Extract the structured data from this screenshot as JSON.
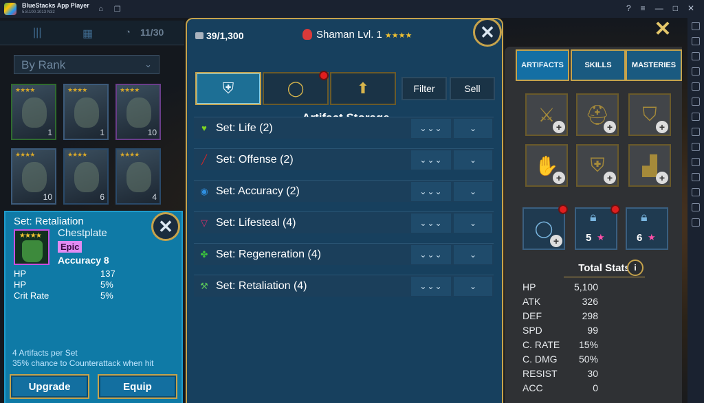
{
  "titlebar": {
    "app_name": "BlueStacks App Player",
    "version": "5.8.100.1013 N32"
  },
  "roster": {
    "count": "11/30",
    "sort_label": "By Rank",
    "heroes": [
      {
        "level": "1"
      },
      {
        "level": "1"
      },
      {
        "level": "10"
      },
      {
        "level": "10"
      },
      {
        "level": "6"
      },
      {
        "level": "4"
      }
    ],
    "hero_stars": "★★★★"
  },
  "artifact_info": {
    "set_title": "Set: Retaliation",
    "item_stars": "★★★★",
    "slot": "Chestplate",
    "rarity": "Epic",
    "main_stat": "Accuracy 8",
    "substats": [
      {
        "name": "HP",
        "value": "137"
      },
      {
        "name": "HP",
        "value": "5%"
      },
      {
        "name": "Crit Rate",
        "value": "5%"
      }
    ],
    "set_bonus_count": "4 Artifacts per Set",
    "set_bonus_effect": "35% chance to Counterattack when hit",
    "upgrade_label": "Upgrade",
    "equip_label": "Equip"
  },
  "modal": {
    "capacity": "39/1,300",
    "hero_name": "Shaman Lvl. 1",
    "hero_stars": "★★★★",
    "filter_label": "Filter",
    "sell_label": "Sell",
    "storage_title": "Artifact Storage",
    "sets": [
      {
        "label": "Set: Life (2)",
        "icon": "heart-icon",
        "color": "#7ed321",
        "glyph": "♥"
      },
      {
        "label": "Set: Offense (2)",
        "icon": "sword-icon",
        "color": "#e02424",
        "glyph": "╱"
      },
      {
        "label": "Set: Accuracy (2)",
        "icon": "target-icon",
        "color": "#2f8fe0",
        "glyph": "◉"
      },
      {
        "label": "Set: Lifesteal (4)",
        "icon": "fangs-icon",
        "color": "#e0306a",
        "glyph": "▽"
      },
      {
        "label": "Set: Regeneration (4)",
        "icon": "clover-icon",
        "color": "#3cc43c",
        "glyph": "✤"
      },
      {
        "label": "Set: Retaliation (4)",
        "icon": "pickaxe-icon",
        "color": "#59c45a",
        "glyph": "⚒"
      }
    ],
    "expand_all_glyph": "⌄⌄⌄",
    "expand_glyph": "⌄"
  },
  "equipment": {
    "tabs": [
      "ARTIFACTS",
      "SKILLS",
      "MASTERIES"
    ],
    "accessory_levels": [
      "5",
      "6"
    ],
    "total_stats_title": "Total Stats",
    "stats": [
      {
        "name": "HP",
        "value": "5,100"
      },
      {
        "name": "ATK",
        "value": "326"
      },
      {
        "name": "DEF",
        "value": "298"
      },
      {
        "name": "SPD",
        "value": "99"
      },
      {
        "name": "C. RATE",
        "value": "15%"
      },
      {
        "name": "C. DMG",
        "value": "50%"
      },
      {
        "name": "RESIST",
        "value": "30"
      },
      {
        "name": "ACC",
        "value": "0"
      }
    ]
  },
  "colors": {
    "accent_gold": "#c6a34c",
    "panel_blue": "#17405e",
    "rarity_epic": "#e28bf2"
  }
}
